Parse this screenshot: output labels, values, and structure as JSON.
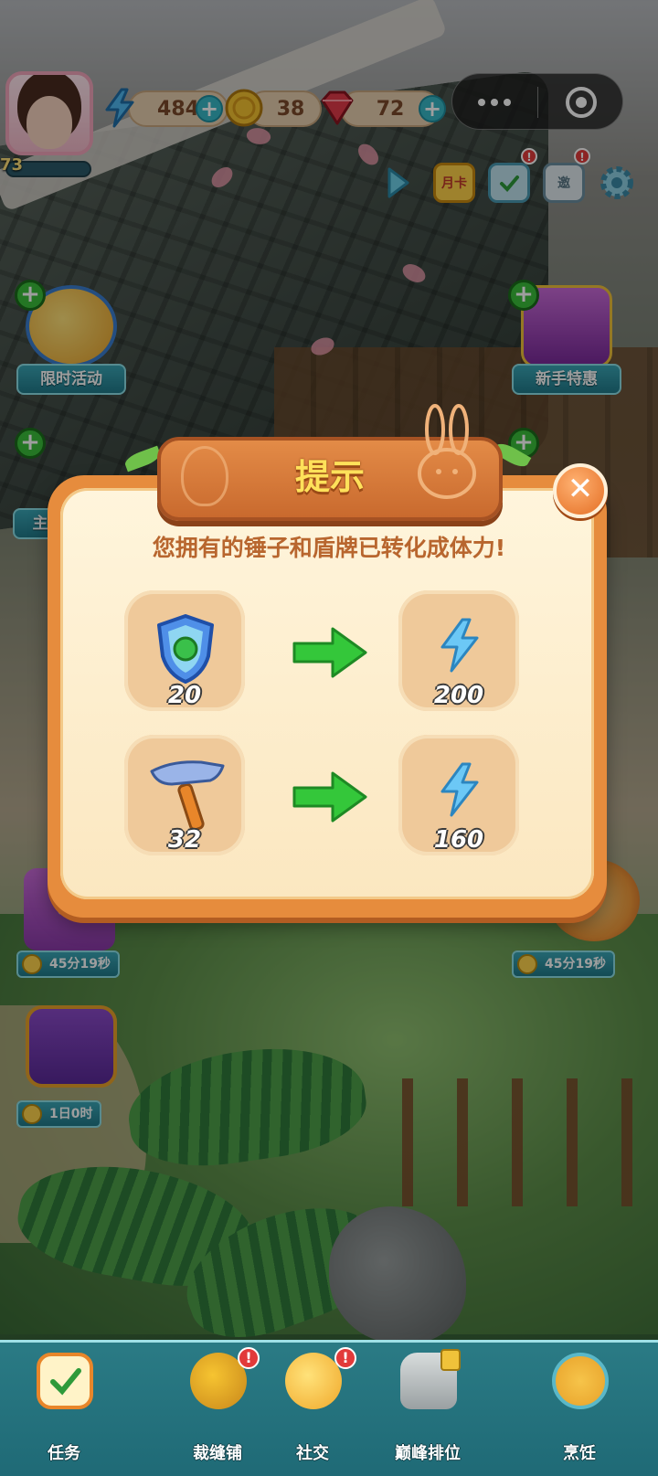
{
  "hud": {
    "level": "73",
    "energy": "484",
    "coins": "38",
    "gems": "72",
    "plus": "+"
  },
  "top_tools": {
    "monthly_card": "月卡",
    "invite": "邀",
    "badge": "!"
  },
  "side_buttons": {
    "limited_event": "限时活动",
    "newbie_deal": "新手特惠",
    "timer_left": "45分19秒",
    "timer_right": "45分19秒",
    "timer_pass": "1日0时",
    "invite_label": "邀",
    "partial_label": "主"
  },
  "dialog": {
    "title": "提示",
    "message": "您拥有的锤子和盾牌已转化成体力!",
    "close": "✕",
    "rows": [
      {
        "item": "shield",
        "item_count": "20",
        "energy": "200"
      },
      {
        "item": "hammer",
        "item_count": "32",
        "energy": "160"
      }
    ]
  },
  "bottom_nav": {
    "tasks": "任务",
    "tailor": "裁缝铺",
    "social": "社交",
    "ranking": "巅峰排位",
    "cooking": "烹饪",
    "badge": "!"
  },
  "colors": {
    "accent_orange": "#e68c3d",
    "title_yellow": "#ffe15a",
    "teal": "#217a8a",
    "green_arrow": "#34c73a"
  }
}
